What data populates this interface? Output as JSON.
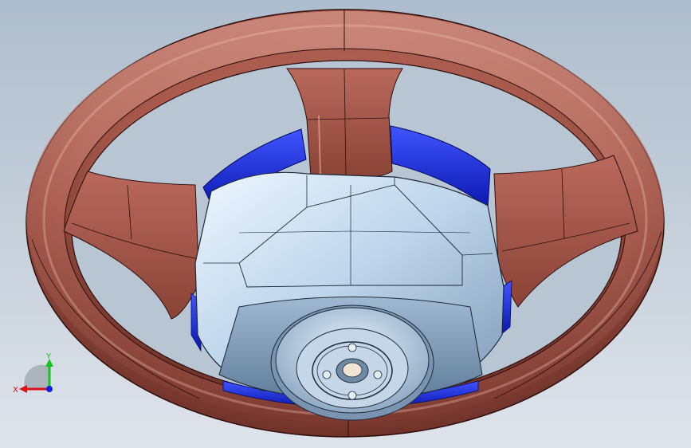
{
  "axes": {
    "x_label": "X",
    "y_label": "Y",
    "x_color": "#e0101a",
    "y_color": "#18c020",
    "z_color": "#1020e0"
  },
  "colors": {
    "wheel_rim": "#a85a4c",
    "wheel_rim_dark": "#6e3128",
    "wheel_rim_light": "#e0a598",
    "hub_light": "#dbe9f7",
    "hub_mid": "#a9c3dd",
    "hub_dark": "#5f7d99",
    "bracket_blue": "#1a2fe0",
    "background_top": "#aebdcd",
    "background_bottom": "#dfe4ea"
  },
  "icons": {
    "triad": "coordinate-triad-icon"
  }
}
